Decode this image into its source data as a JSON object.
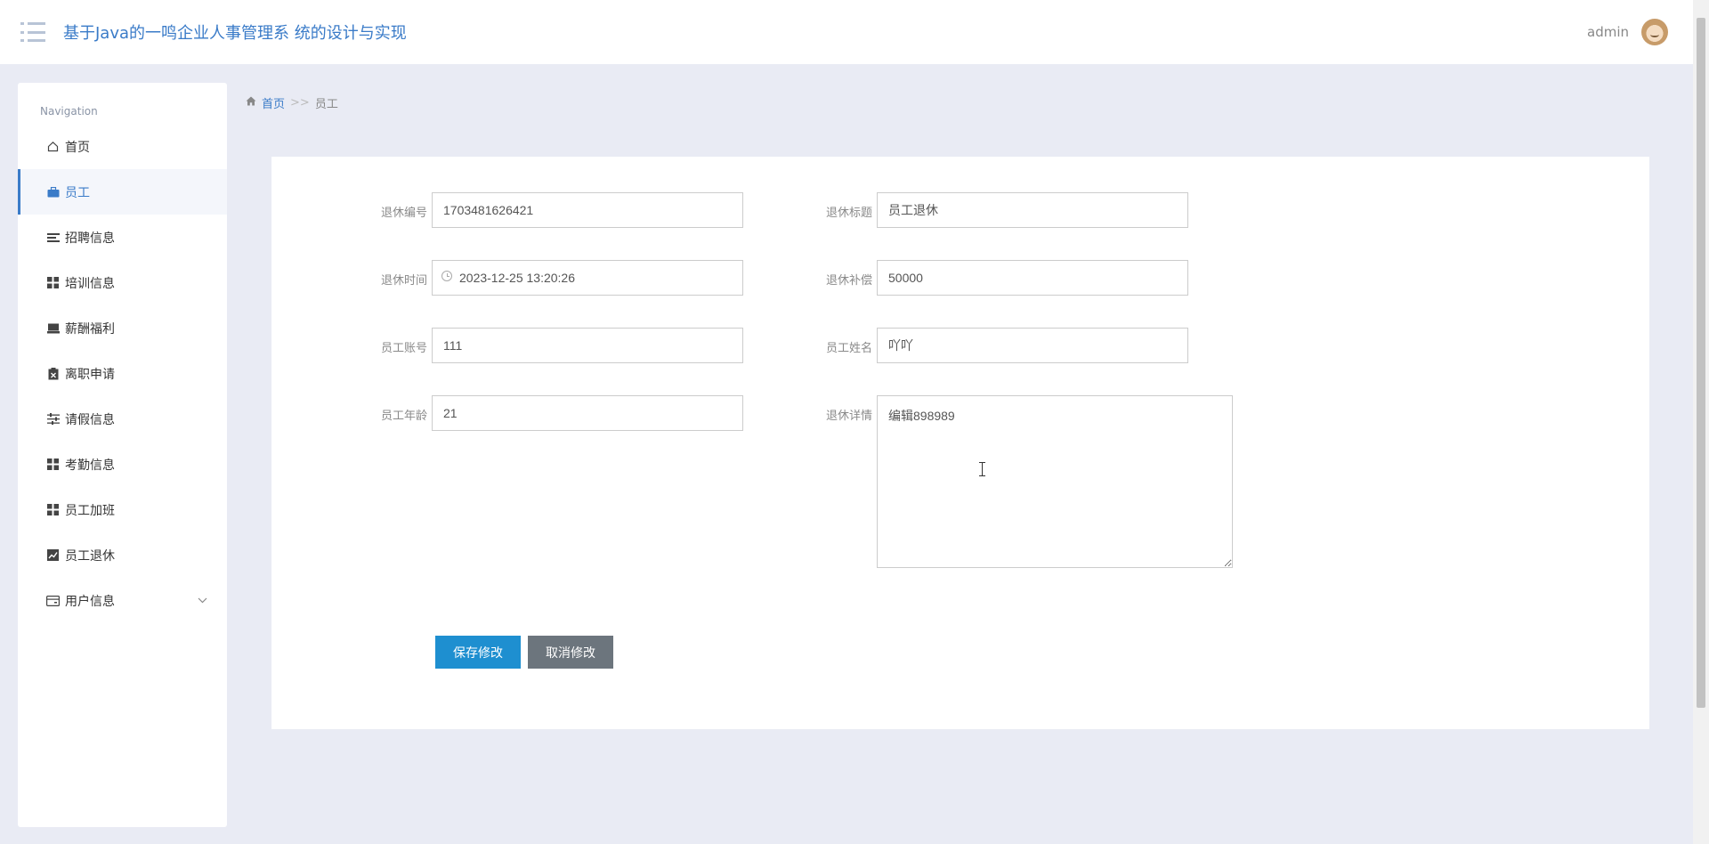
{
  "app": {
    "title": "基于Java的一鸣企业人事管理系 统的设计与实现",
    "username": "admin"
  },
  "sidebar": {
    "heading": "Navigation",
    "items": [
      {
        "label": "首页",
        "icon": "home-icon"
      },
      {
        "label": "员工",
        "icon": "briefcase-icon"
      },
      {
        "label": "招聘信息",
        "icon": "list-icon"
      },
      {
        "label": "培训信息",
        "icon": "grid-icon"
      },
      {
        "label": "薪酬福利",
        "icon": "inbox-icon"
      },
      {
        "label": "离职申请",
        "icon": "clipboard-icon"
      },
      {
        "label": "请假信息",
        "icon": "sliders-icon"
      },
      {
        "label": "考勤信息",
        "icon": "grid-icon"
      },
      {
        "label": "员工加班",
        "icon": "grid-icon"
      },
      {
        "label": "员工退休",
        "icon": "chart-icon"
      },
      {
        "label": "用户信息",
        "icon": "card-icon"
      }
    ]
  },
  "breadcrumb": {
    "home": "首页",
    "separator": ">>",
    "current": "员工"
  },
  "form": {
    "retire_no": {
      "label": "退休编号",
      "value": "1703481626421"
    },
    "retire_title": {
      "label": "退休标题",
      "value": "员工退休"
    },
    "retire_time": {
      "label": "退休时间",
      "value": "2023-12-25 13:20:26"
    },
    "retire_comp": {
      "label": "退休补偿",
      "value": "50000"
    },
    "emp_account": {
      "label": "员工账号",
      "value": "111"
    },
    "emp_name": {
      "label": "员工姓名",
      "value": "吖吖"
    },
    "emp_age": {
      "label": "员工年龄",
      "value": "21"
    },
    "retire_detail": {
      "label": "退休详情",
      "value": "编辑898989"
    },
    "save_label": "保存修改",
    "cancel_label": "取消修改"
  },
  "colors": {
    "accent": "#3a7bc8",
    "save": "#1e8fd0",
    "cancel": "#6c757d",
    "background": "#e9ebf4"
  }
}
